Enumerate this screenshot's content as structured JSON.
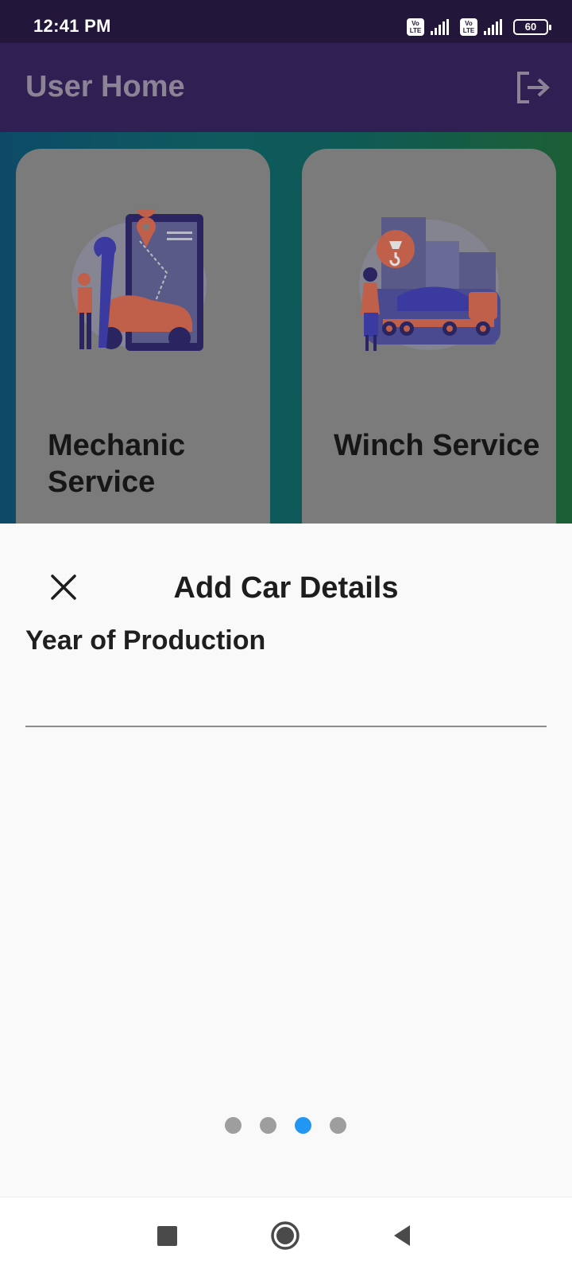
{
  "status_bar": {
    "time": "12:41 PM",
    "sim1_badge": "Vo LTE",
    "sim2_badge": "Vo LTE",
    "battery": "60"
  },
  "app_bar": {
    "title": "User Home",
    "logout_icon": "logout-icon"
  },
  "services": [
    {
      "title": "Mechanic Service",
      "icon": "mechanic-illustration"
    },
    {
      "title": "Winch Service",
      "icon": "tow-truck-illustration"
    }
  ],
  "sheet": {
    "title": "Add Car Details",
    "close_icon": "close-icon",
    "field_label": "Year of Production",
    "field_value": "",
    "page_count": 4,
    "active_page": 3
  },
  "colors": {
    "status_bar": "#22163a",
    "app_bar": "#2f1f52",
    "card": "#7b7b7b",
    "active_dot": "#2196f3",
    "inactive_dot": "#9e9e9e"
  },
  "nav": {
    "recents_icon": "square-icon",
    "home_icon": "circle-icon",
    "back_icon": "triangle-back-icon"
  }
}
